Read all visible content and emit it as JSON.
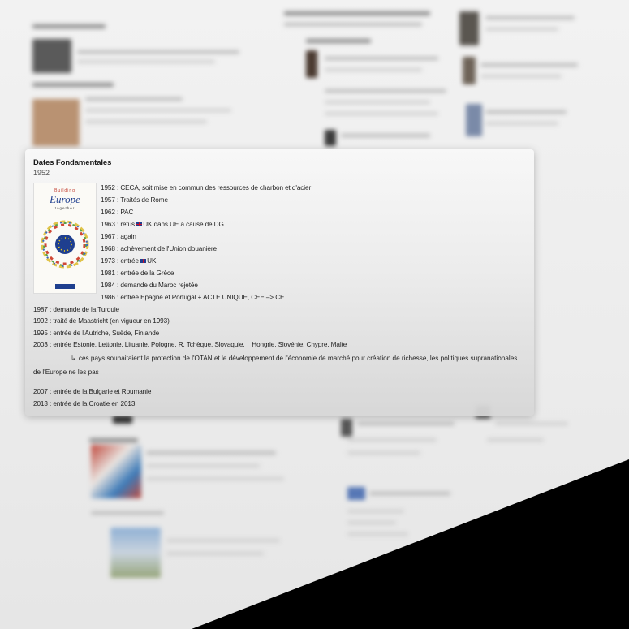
{
  "card": {
    "title": "Dates Fondamentales",
    "subtitle": "1952",
    "poster": {
      "top_text": "Building",
      "title": "Europe",
      "bottom_text": "together",
      "icon": "eu-stars-circle-icon"
    },
    "entries": [
      {
        "text": "1952 : CECA, soit mise en commun des ressources de charbon et d'acier"
      },
      {
        "text": "1957 : Traités de Rome"
      },
      {
        "text": "1962 : PAC"
      },
      {
        "text_before": "1963 : refus ",
        "flag": "uk-flag-icon",
        "text_after": "UK dans UE à cause de DG"
      },
      {
        "text": "1967 : again"
      },
      {
        "text": "1968 : achèvement de l'Union douanière"
      },
      {
        "text_before": "1973 : entrée ",
        "flag": "uk-flag-icon",
        "text_after": "UK"
      },
      {
        "text": "1981 : entrée de la Grèce"
      },
      {
        "text": "1984 : demande du Maroc rejetée"
      },
      {
        "text": "1986 : entrée Epagne et Portugal + ACTE UNIQUE, CEE –> CE"
      },
      {
        "text": "1987 : demande de la Turquie"
      },
      {
        "text": "1992 : traité de Maastricht (en vigueur en 1993)"
      },
      {
        "text": "1995 : entrée de l'Autriche, Suède, Finlande"
      },
      {
        "text": "2003 : entrée Estonie, Lettonie, Lituanie, Pologne, R. Tchèque, Slovaquie,    Hongrie, Slovénie, Chypre, Malte"
      }
    ],
    "note": {
      "arrow": "↳",
      "text": "ces pays souhaitaient la protection de l'OTAN et le développement de l'économie de marché pour création de richesse, les politiques supranationales de l'Europe ne les pas"
    },
    "later_entries": [
      {
        "text": "2007 : entrée de la Bulgarie et Roumanie"
      },
      {
        "text": "2013 : entrée de la Croatie en 2013"
      }
    ]
  },
  "colors": {
    "background": "#000000",
    "page": "#efefef",
    "card": "#ececec",
    "text": "#222222",
    "eu_blue": "#1f3f8f",
    "uk_red": "#c8102e"
  }
}
